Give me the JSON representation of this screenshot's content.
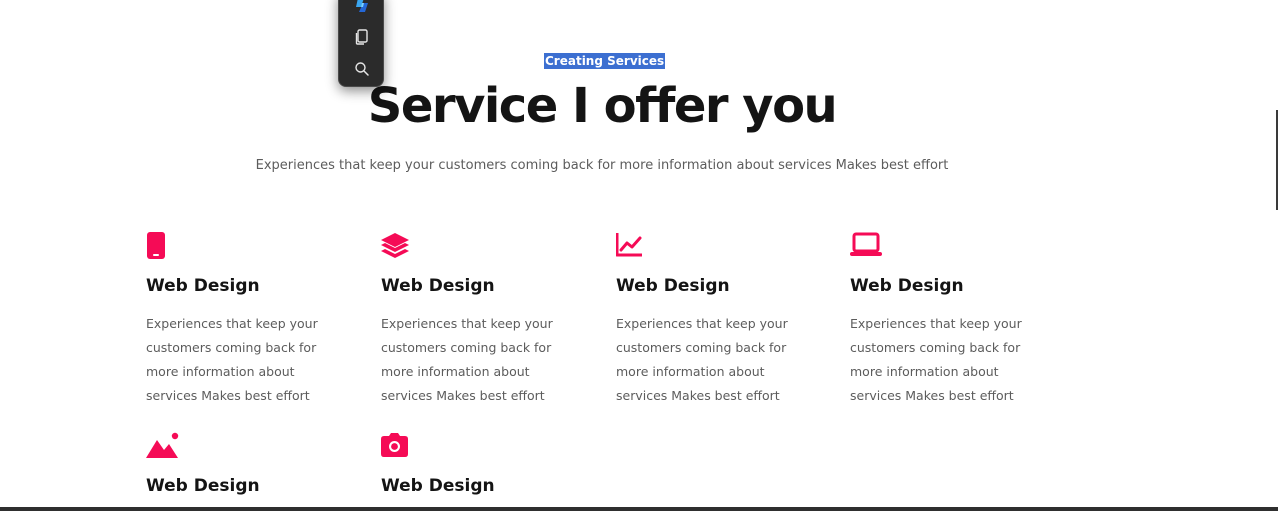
{
  "toolbar": {
    "buttons": [
      {
        "name": "copilot-icon"
      },
      {
        "name": "copy-icon"
      },
      {
        "name": "search-icon"
      }
    ]
  },
  "header": {
    "eyebrow": "Creating Services",
    "title": "Service I offer you",
    "subtitle": "Experiences that keep your customers coming back for more information about services Makes best effort"
  },
  "accent_color": "#f50b56",
  "selection_color": "#3c6fd1",
  "services": [
    {
      "icon": "mobile-icon",
      "title": "Web Design",
      "text": "Experiences that keep your customers coming back for more information about services Makes best effort"
    },
    {
      "icon": "layers-icon",
      "title": "Web Design",
      "text": "Experiences that keep your customers coming back for more information about services Makes best effort"
    },
    {
      "icon": "chart-line-icon",
      "title": "Web Design",
      "text": "Experiences that keep your customers coming back for more information about services Makes best effort"
    },
    {
      "icon": "laptop-icon",
      "title": "Web Design",
      "text": "Experiences that keep your customers coming back for more information about services Makes best effort"
    },
    {
      "icon": "image-icon",
      "title": "Web Design",
      "text": ""
    },
    {
      "icon": "camera-icon",
      "title": "Web Design",
      "text": ""
    }
  ]
}
